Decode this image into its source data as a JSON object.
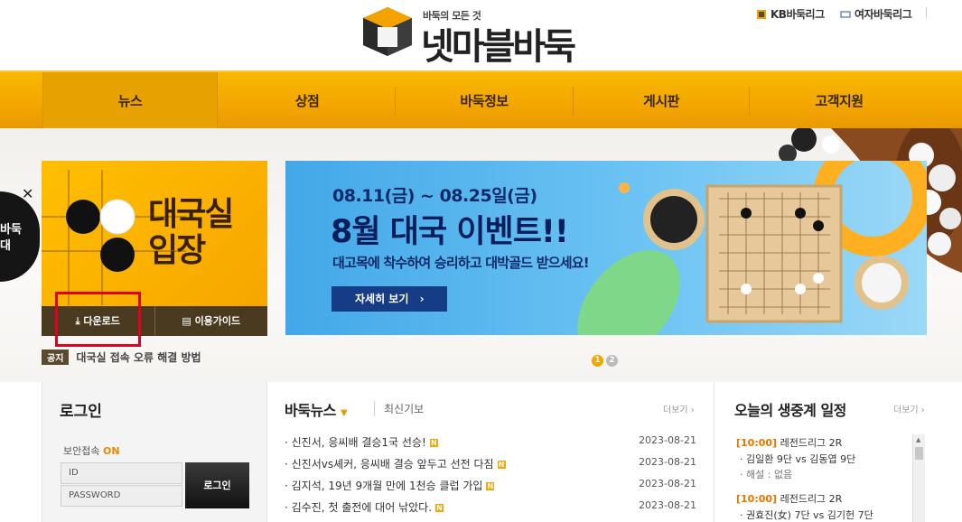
{
  "header": {
    "logo_tagline": "바둑의 모든 것",
    "logo_name": "넷마블바둑",
    "links": [
      {
        "label": "KB바둑리그"
      },
      {
        "label": "여자바둑리그"
      }
    ]
  },
  "nav": {
    "items": [
      {
        "label": "뉴스"
      },
      {
        "label": "상점"
      },
      {
        "label": "바둑정보"
      },
      {
        "label": "게시판"
      },
      {
        "label": "고객지원"
      }
    ],
    "active_index": 0
  },
  "left_ad": {
    "text": "바둑\n대"
  },
  "entry": {
    "title_line1": "대국실",
    "title_line2": "입장",
    "download_label": "다운로드",
    "guide_label": "이용가이드"
  },
  "notice": {
    "tag": "공지",
    "text": "대국실 접속 오류 해결 방법"
  },
  "banner": {
    "date": "08.11(금) ~ 08.25일(금)",
    "headline": "8월 대국 이벤트!!",
    "subtitle": "대고목에 착수하여 승리하고 대박골드 받으세요!",
    "cta": "자세히 보기"
  },
  "pager": {
    "pages": [
      "1",
      "2"
    ],
    "current": "1"
  },
  "login": {
    "title": "로그인",
    "security_label": "보안접속",
    "security_state": "ON",
    "id_placeholder": "ID",
    "pw_placeholder": "PASSWORD",
    "submit": "로그인"
  },
  "news": {
    "title": "바둑뉴스",
    "tab": "최신기보",
    "more": "더보기",
    "items": [
      {
        "title": "신진서, 응씨배 결승1국 선승!",
        "date": "2023-08-21"
      },
      {
        "title": "신진서vs셰커, 응씨배 결승 앞두고 선전 다짐",
        "date": "2023-08-21"
      },
      {
        "title": "김지석, 19년 9개월 만에 1천승 클럽 가입",
        "date": "2023-08-21"
      },
      {
        "title": "김수진, 첫 출전에 대어 낚았다.",
        "date": "2023-08-21"
      }
    ],
    "new_badge": "N"
  },
  "schedule": {
    "title": "오늘의 생중계 일정",
    "more": "더보기",
    "items": [
      {
        "time": "[10:00]",
        "event": "레전드리그 2R",
        "match": "김일환 9단 vs 김동엽 9단",
        "note": "해설 : 없음"
      },
      {
        "time": "[10:00]",
        "event": "레전드리그 2R",
        "match": "권효진(女) 7단 vs 김기헌 7단"
      }
    ]
  },
  "colors": {
    "nav": "#f3a600",
    "accent": "#e89a00",
    "banner": "#43a8e8",
    "alert_box": "#e1001f"
  }
}
